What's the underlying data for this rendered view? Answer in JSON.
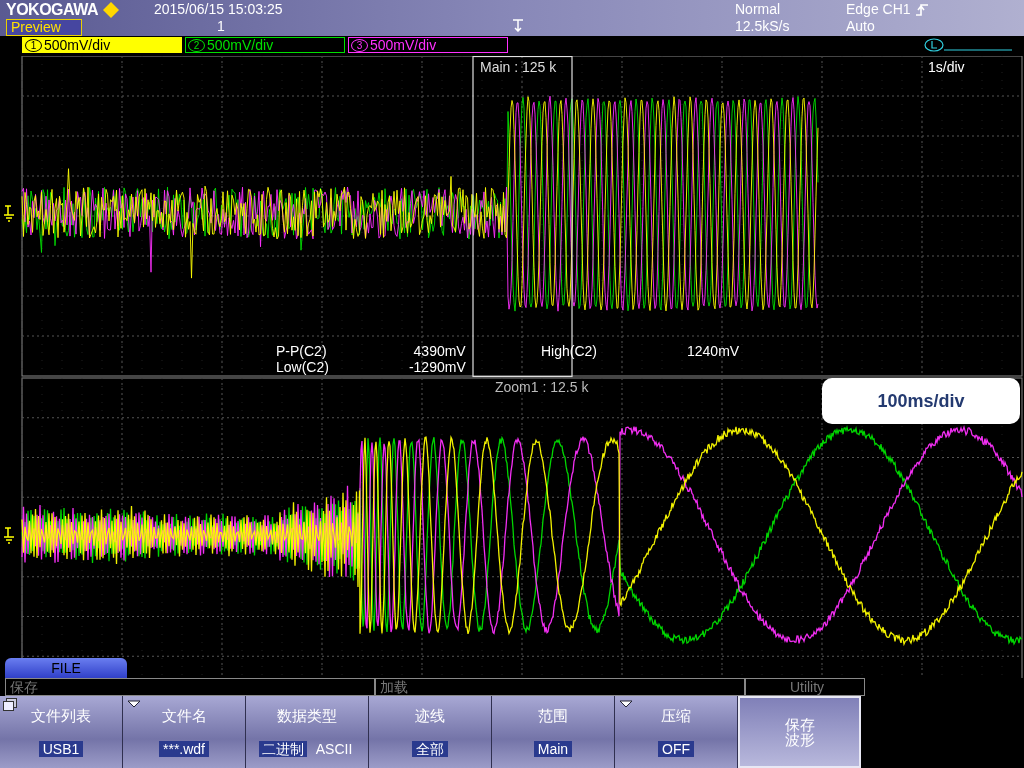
{
  "header": {
    "brand": "YOKOGAWA",
    "mode_badge": "Preview",
    "date_time": "2015/06/15 15:03:25",
    "acquisition_count": "1",
    "acquisition_mode": "Normal",
    "sample_rate": "12.5kS/s",
    "trigger": "Edge CH1",
    "trigger_mode": "Auto"
  },
  "channels": [
    {
      "number": "1",
      "scale": "500mV/div",
      "color": "#ffff00",
      "selected": true
    },
    {
      "number": "2",
      "scale": "500mV/div",
      "color": "#00e000",
      "selected": false
    },
    {
      "number": "3",
      "scale": "500mV/div",
      "color": "#ff30ff",
      "selected": false
    }
  ],
  "main": {
    "label": "Main : 125 k",
    "timebase": "1s/div",
    "measurement_columns": [
      {
        "items": [
          {
            "name": "P-P(C2)",
            "value": "4390mV"
          },
          {
            "name": "Low(C2)",
            "value": "-1290mV"
          }
        ]
      },
      {
        "items": [
          {
            "name": "High(C2)",
            "value": "1240mV"
          }
        ]
      }
    ]
  },
  "zoom": {
    "label": "Zoom1 : 12.5 k",
    "timebase": "100ms/div"
  },
  "menu": {
    "title": "FILE",
    "sub_tabs": [
      "保存",
      "加载",
      "Utility"
    ],
    "softkeys": [
      {
        "kind": "value",
        "label": "文件列表",
        "value": "USB1",
        "dropdown": false,
        "list_icon": true
      },
      {
        "kind": "value",
        "label": "文件名",
        "value": "***.wdf",
        "dropdown": true,
        "list_icon": false
      },
      {
        "kind": "options",
        "label": "数据类型",
        "options": [
          {
            "label": "二进制",
            "selected": true
          },
          {
            "label": "ASCII",
            "selected": false
          }
        ],
        "dropdown": false,
        "list_icon": false
      },
      {
        "kind": "value",
        "label": "迹线",
        "value": "全部",
        "dropdown": false,
        "list_icon": false
      },
      {
        "kind": "value",
        "label": "范围",
        "value": "Main",
        "dropdown": false,
        "list_icon": false
      },
      {
        "kind": "value",
        "label": "压缩",
        "value": "OFF",
        "dropdown": true,
        "list_icon": false
      },
      {
        "kind": "action",
        "label": "保存波形",
        "dropdown": false,
        "list_icon": false
      }
    ]
  }
}
